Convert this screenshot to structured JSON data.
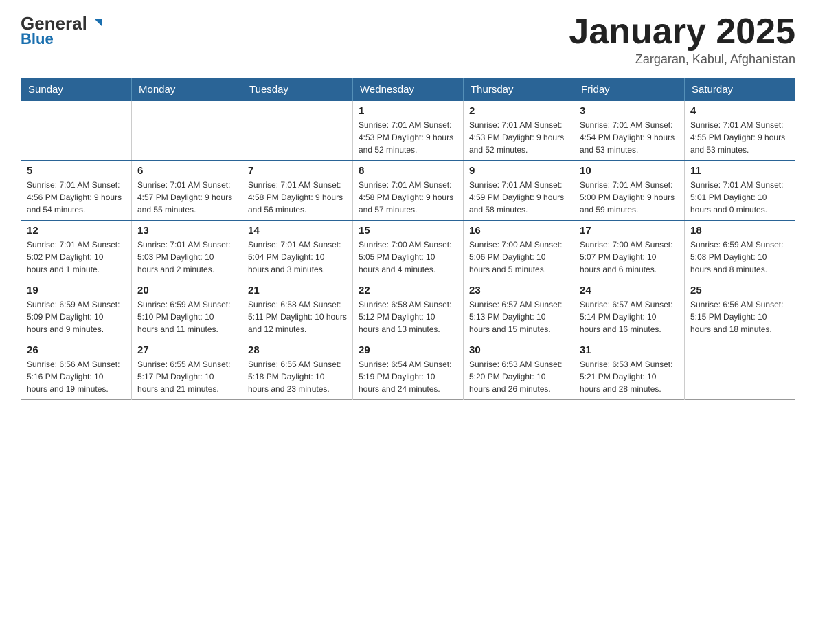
{
  "header": {
    "logo_text_general": "General",
    "logo_text_blue": "Blue",
    "month_title": "January 2025",
    "location": "Zargaran, Kabul, Afghanistan"
  },
  "days_of_week": [
    "Sunday",
    "Monday",
    "Tuesday",
    "Wednesday",
    "Thursday",
    "Friday",
    "Saturday"
  ],
  "weeks": [
    [
      {
        "day": "",
        "info": ""
      },
      {
        "day": "",
        "info": ""
      },
      {
        "day": "",
        "info": ""
      },
      {
        "day": "1",
        "info": "Sunrise: 7:01 AM\nSunset: 4:53 PM\nDaylight: 9 hours\nand 52 minutes."
      },
      {
        "day": "2",
        "info": "Sunrise: 7:01 AM\nSunset: 4:53 PM\nDaylight: 9 hours\nand 52 minutes."
      },
      {
        "day": "3",
        "info": "Sunrise: 7:01 AM\nSunset: 4:54 PM\nDaylight: 9 hours\nand 53 minutes."
      },
      {
        "day": "4",
        "info": "Sunrise: 7:01 AM\nSunset: 4:55 PM\nDaylight: 9 hours\nand 53 minutes."
      }
    ],
    [
      {
        "day": "5",
        "info": "Sunrise: 7:01 AM\nSunset: 4:56 PM\nDaylight: 9 hours\nand 54 minutes."
      },
      {
        "day": "6",
        "info": "Sunrise: 7:01 AM\nSunset: 4:57 PM\nDaylight: 9 hours\nand 55 minutes."
      },
      {
        "day": "7",
        "info": "Sunrise: 7:01 AM\nSunset: 4:58 PM\nDaylight: 9 hours\nand 56 minutes."
      },
      {
        "day": "8",
        "info": "Sunrise: 7:01 AM\nSunset: 4:58 PM\nDaylight: 9 hours\nand 57 minutes."
      },
      {
        "day": "9",
        "info": "Sunrise: 7:01 AM\nSunset: 4:59 PM\nDaylight: 9 hours\nand 58 minutes."
      },
      {
        "day": "10",
        "info": "Sunrise: 7:01 AM\nSunset: 5:00 PM\nDaylight: 9 hours\nand 59 minutes."
      },
      {
        "day": "11",
        "info": "Sunrise: 7:01 AM\nSunset: 5:01 PM\nDaylight: 10 hours\nand 0 minutes."
      }
    ],
    [
      {
        "day": "12",
        "info": "Sunrise: 7:01 AM\nSunset: 5:02 PM\nDaylight: 10 hours\nand 1 minute."
      },
      {
        "day": "13",
        "info": "Sunrise: 7:01 AM\nSunset: 5:03 PM\nDaylight: 10 hours\nand 2 minutes."
      },
      {
        "day": "14",
        "info": "Sunrise: 7:01 AM\nSunset: 5:04 PM\nDaylight: 10 hours\nand 3 minutes."
      },
      {
        "day": "15",
        "info": "Sunrise: 7:00 AM\nSunset: 5:05 PM\nDaylight: 10 hours\nand 4 minutes."
      },
      {
        "day": "16",
        "info": "Sunrise: 7:00 AM\nSunset: 5:06 PM\nDaylight: 10 hours\nand 5 minutes."
      },
      {
        "day": "17",
        "info": "Sunrise: 7:00 AM\nSunset: 5:07 PM\nDaylight: 10 hours\nand 6 minutes."
      },
      {
        "day": "18",
        "info": "Sunrise: 6:59 AM\nSunset: 5:08 PM\nDaylight: 10 hours\nand 8 minutes."
      }
    ],
    [
      {
        "day": "19",
        "info": "Sunrise: 6:59 AM\nSunset: 5:09 PM\nDaylight: 10 hours\nand 9 minutes."
      },
      {
        "day": "20",
        "info": "Sunrise: 6:59 AM\nSunset: 5:10 PM\nDaylight: 10 hours\nand 11 minutes."
      },
      {
        "day": "21",
        "info": "Sunrise: 6:58 AM\nSunset: 5:11 PM\nDaylight: 10 hours\nand 12 minutes."
      },
      {
        "day": "22",
        "info": "Sunrise: 6:58 AM\nSunset: 5:12 PM\nDaylight: 10 hours\nand 13 minutes."
      },
      {
        "day": "23",
        "info": "Sunrise: 6:57 AM\nSunset: 5:13 PM\nDaylight: 10 hours\nand 15 minutes."
      },
      {
        "day": "24",
        "info": "Sunrise: 6:57 AM\nSunset: 5:14 PM\nDaylight: 10 hours\nand 16 minutes."
      },
      {
        "day": "25",
        "info": "Sunrise: 6:56 AM\nSunset: 5:15 PM\nDaylight: 10 hours\nand 18 minutes."
      }
    ],
    [
      {
        "day": "26",
        "info": "Sunrise: 6:56 AM\nSunset: 5:16 PM\nDaylight: 10 hours\nand 19 minutes."
      },
      {
        "day": "27",
        "info": "Sunrise: 6:55 AM\nSunset: 5:17 PM\nDaylight: 10 hours\nand 21 minutes."
      },
      {
        "day": "28",
        "info": "Sunrise: 6:55 AM\nSunset: 5:18 PM\nDaylight: 10 hours\nand 23 minutes."
      },
      {
        "day": "29",
        "info": "Sunrise: 6:54 AM\nSunset: 5:19 PM\nDaylight: 10 hours\nand 24 minutes."
      },
      {
        "day": "30",
        "info": "Sunrise: 6:53 AM\nSunset: 5:20 PM\nDaylight: 10 hours\nand 26 minutes."
      },
      {
        "day": "31",
        "info": "Sunrise: 6:53 AM\nSunset: 5:21 PM\nDaylight: 10 hours\nand 28 minutes."
      },
      {
        "day": "",
        "info": ""
      }
    ]
  ]
}
